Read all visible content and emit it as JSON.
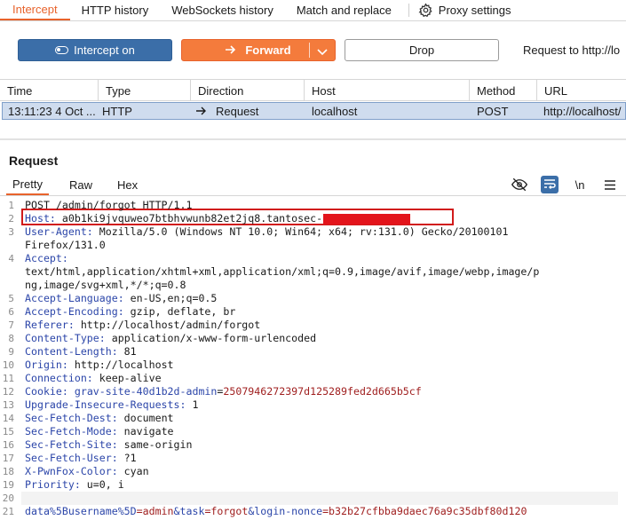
{
  "tabs": [
    {
      "label": "Intercept",
      "active": true
    },
    {
      "label": "HTTP history"
    },
    {
      "label": "WebSockets history"
    },
    {
      "label": "Match and replace"
    },
    {
      "label": "Proxy settings",
      "icon": "gear-icon"
    }
  ],
  "toolbar": {
    "intercept_label": "Intercept on",
    "forward_label": "Forward",
    "drop_label": "Drop",
    "request_to": "Request to http://lo"
  },
  "history": {
    "columns": [
      "Time",
      "Type",
      "Direction",
      "Host",
      "Method",
      "URL"
    ],
    "row": {
      "time": "13:11:23 4 Oct ...",
      "type": "HTTP",
      "direction": "Request",
      "host": "localhost",
      "method": "POST",
      "url": "http://localhost/"
    }
  },
  "request": {
    "title": "Request",
    "subtabs": [
      "Pretty",
      "Raw",
      "Hex"
    ],
    "active_subtab": "Pretty",
    "icons": [
      "eye-off-icon",
      "wrap-icon",
      "newline-icon",
      "menu-icon"
    ],
    "newline_label": "\\n"
  },
  "editor": {
    "line_numbers": [
      "1",
      "2",
      "3",
      "",
      "4",
      "",
      "",
      "5",
      "6",
      "7",
      "8",
      "9",
      "10",
      "11",
      "12",
      "13",
      "14",
      "15",
      "16",
      "17",
      "18",
      "19",
      "20",
      "21"
    ],
    "l1": "POST /admin/forgot HTTP/1.1",
    "l2_key": "Host:",
    "l2_val": " a0b1ki9jvquweo7btbhvwunb82et2jq8.tantosec-",
    "l3_key": "User-Agent:",
    "l3_val": " Mozilla/5.0 (Windows NT 10.0; Win64; x64; rv:131.0) Gecko/20100101",
    "l3b": "Firefox/131.0",
    "l4_key": "Accept:",
    "l4a": "text/html,application/xhtml+xml,application/xml;q=0.9,image/avif,image/webp,image/p",
    "l4b": "ng,image/svg+xml,*/*;q=0.8",
    "l5_key": "Accept-Language:",
    "l5_val": " en-US,en;q=0.5",
    "l6_key": "Accept-Encoding:",
    "l6_val": " gzip, deflate, br",
    "l7_key": "Referer:",
    "l7_val": " http://localhost/admin/forgot",
    "l8_key": "Content-Type:",
    "l8_val": " application/x-www-form-urlencoded",
    "l9_key": "Content-Length:",
    "l9_val": " 81",
    "l10_key": "Origin:",
    "l10_val": " http://localhost",
    "l11_key": "Connection:",
    "l11_val": " keep-alive",
    "l12_key": "Cookie:",
    "l12_ck": " grav-site-40d1b2d-admin",
    "l12_eq": "=",
    "l12_cv": "2507946272397d125289fed2d665b5cf",
    "l13_key": "Upgrade-Insecure-Requests:",
    "l13_val": " 1",
    "l14_key": "Sec-Fetch-Dest:",
    "l14_val": " document",
    "l15_key": "Sec-Fetch-Mode:",
    "l15_val": " navigate",
    "l16_key": "Sec-Fetch-Site:",
    "l16_val": " same-origin",
    "l17_key": "Sec-Fetch-User:",
    "l17_val": " ?1",
    "l18_key": "X-PwnFox-Color:",
    "l18_val": " cyan",
    "l19_key": "Priority:",
    "l19_val": " u=0, i",
    "l21_p1k": "data%5Busername%5D",
    "l21_p1v": "=admin",
    "l21_p2k": "&task",
    "l21_p2v": "=forgot",
    "l21_p3k": "&login-nonce",
    "l21_p3v": "=b32b27cfbba9daec76a9c35dbf80d120"
  },
  "colors": {
    "accent": "#e8632c",
    "intercept_button": "#3b6ea8",
    "forward_button": "#f47b3c",
    "selected_row": "#cfdcee",
    "highlight_box": "#d11a1a",
    "redaction": "#e3141b"
  }
}
